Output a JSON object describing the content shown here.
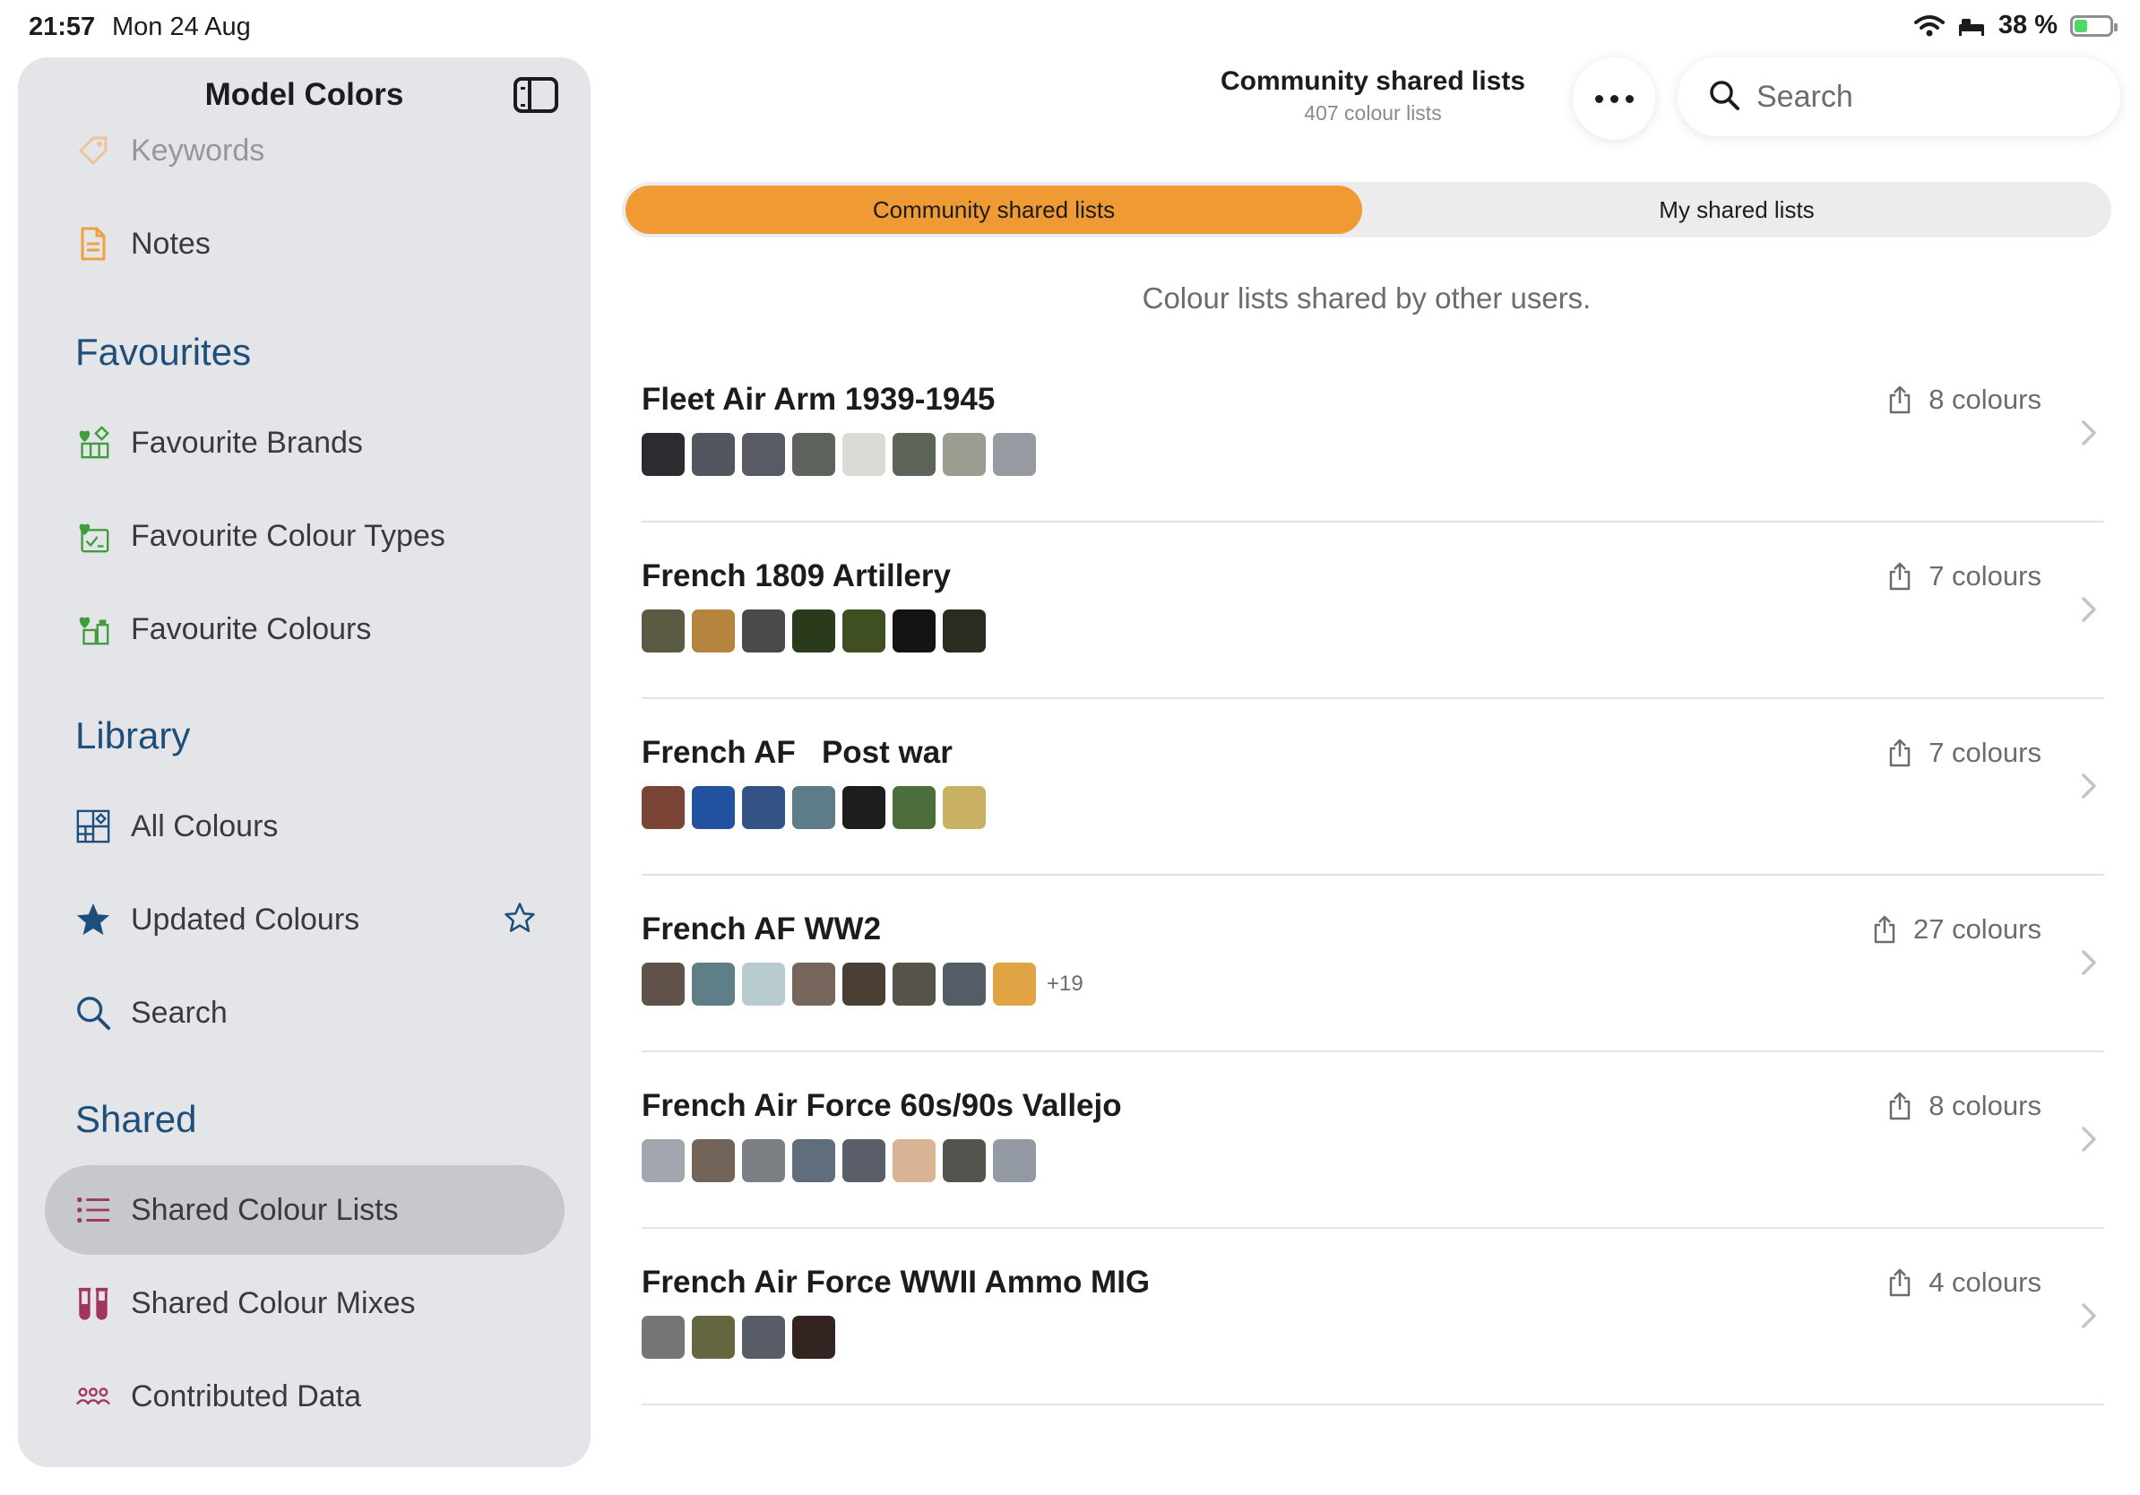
{
  "status_bar": {
    "time": "21:57",
    "date": "Mon 24 Aug",
    "battery": "38 %",
    "battery_level": 0.38
  },
  "sidebar": {
    "title": "Model Colors",
    "items_top": [
      {
        "label": "Keywords",
        "icon": "tag-icon",
        "faded": true
      },
      {
        "label": "Notes",
        "icon": "document-icon"
      }
    ],
    "sections": {
      "favourites": "Favourites",
      "library": "Library",
      "shared": "Shared"
    },
    "favourites": [
      {
        "label": "Favourite Brands",
        "icon": "heart-brands-icon"
      },
      {
        "label": "Favourite Colour Types",
        "icon": "heart-types-icon"
      },
      {
        "label": "Favourite Colours",
        "icon": "heart-colours-icon"
      }
    ],
    "library": [
      {
        "label": "All Colours",
        "icon": "grid-icon"
      },
      {
        "label": "Updated Colours",
        "icon": "star-icon",
        "trailing_icon": "star-outline-icon"
      },
      {
        "label": "Search",
        "icon": "search-icon"
      }
    ],
    "shared": [
      {
        "label": "Shared Colour Lists",
        "icon": "list-icon",
        "selected": true
      },
      {
        "label": "Shared Colour Mixes",
        "icon": "test-tubes-icon"
      },
      {
        "label": "Contributed Data",
        "icon": "people-icon"
      }
    ]
  },
  "header": {
    "title": "Community shared lists",
    "subtitle": "407 colour lists",
    "more_icon": "ellipsis-icon",
    "search_placeholder": "Search"
  },
  "segment": {
    "active": "Community shared lists",
    "inactive": "My shared lists",
    "accent": "#f09a34"
  },
  "subtitle": "Colour lists shared by other users.",
  "lists": [
    {
      "name": "Fleet Air Arm 1939-1945",
      "count": "8 colours",
      "swatches": [
        "#2a2c30",
        "#51565f",
        "#585b63",
        "#5e625c",
        "#d9dbd4",
        "#5c6359",
        "#999e90",
        "#979aa0"
      ],
      "more": ""
    },
    {
      "name": "French 1809 Artillery",
      "count": "7 colours",
      "swatches": [
        "#5b5a43",
        "#b5843f",
        "#4a4a48",
        "#2c3a1c",
        "#3f4f22",
        "#141412",
        "#2c2b22"
      ],
      "more": ""
    },
    {
      "name": "French AF   Post war",
      "count": "7 colours",
      "swatches": [
        "#7a4536",
        "#2252a0",
        "#335385",
        "#5e7b88",
        "#1d1d1d",
        "#4c6e3a",
        "#c8b163"
      ],
      "more": ""
    },
    {
      "name": "French AF WW2",
      "count": "27 colours",
      "swatches": [
        "#60514a",
        "#5e7e88",
        "#b8ccd0",
        "#76655a",
        "#4a3f34",
        "#56534a",
        "#545c67",
        "#e0a444"
      ],
      "more": "+19"
    },
    {
      "name": "French Air Force 60s/90s Vallejo",
      "count": "8 colours",
      "swatches": [
        "#a2a7af",
        "#73645a",
        "#7b7e83",
        "#5f6d7c",
        "#5a5e69",
        "#d9b393",
        "#52544d",
        "#949aa3"
      ],
      "more": ""
    },
    {
      "name": "French Air Force WWII Ammo MIG",
      "count": "4 colours",
      "swatches": [
        "#737577",
        "#646640",
        "#585c66",
        "#342421"
      ],
      "more": ""
    }
  ]
}
